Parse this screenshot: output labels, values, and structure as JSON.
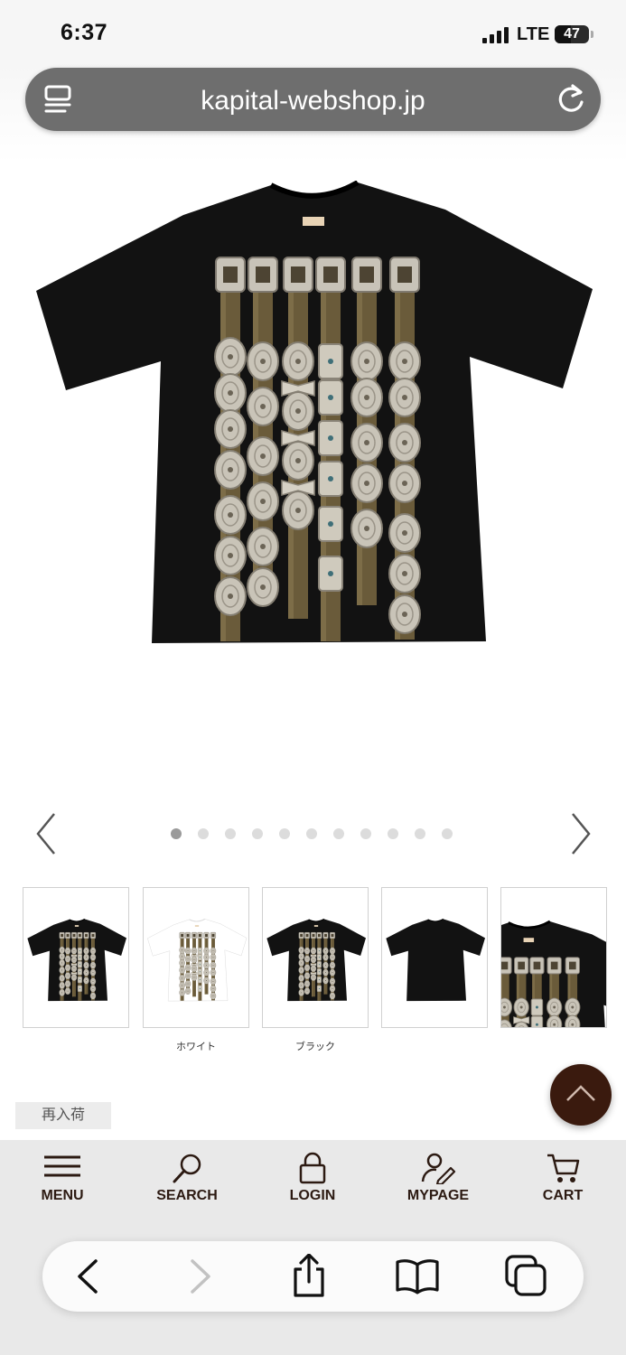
{
  "status_bar": {
    "time": "6:37",
    "network": "LTE",
    "battery": "47",
    "battery_level": 0.47
  },
  "browser": {
    "url": "kapital-webshop.jp",
    "tabs_icon": "tab-overview-icon",
    "reload_icon": "reload-icon"
  },
  "carousel": {
    "slide_count": 11,
    "active_index": 0,
    "prev_icon": "chevron-left-icon",
    "next_icon": "chevron-right-icon"
  },
  "thumbnails": [
    {
      "caption": ""
    },
    {
      "caption": "ホワイト"
    },
    {
      "caption": "ブラック"
    },
    {
      "caption": ""
    },
    {
      "caption": ""
    }
  ],
  "restock_badge": "再入荷",
  "back_to_top_icon": "chevron-up-icon",
  "site_nav": [
    {
      "label": "MENU",
      "icon": "hamburger-icon"
    },
    {
      "label": "SEARCH",
      "icon": "search-icon"
    },
    {
      "label": "LOGIN",
      "icon": "lock-icon"
    },
    {
      "label": "MYPAGE",
      "icon": "user-edit-icon"
    },
    {
      "label": "CART",
      "icon": "cart-icon"
    }
  ],
  "safari_toolbar": [
    "back-icon",
    "forward-icon",
    "share-icon",
    "bookmarks-icon",
    "tabs-icon"
  ],
  "colors": {
    "brand": "#3a1a0e",
    "nav_bg": "#e9e9e9",
    "url_bar": "#6e6e6e",
    "shirt": "#121212"
  }
}
